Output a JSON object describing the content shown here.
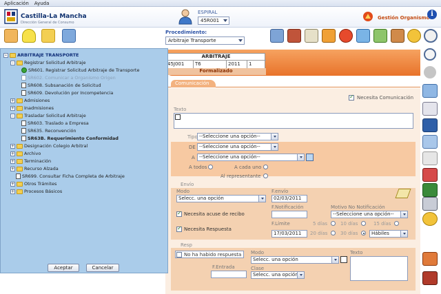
{
  "menubar": {
    "items": [
      "Aplicación",
      "Ayuda"
    ]
  },
  "header": {
    "brand_name": "Castilla-La Mancha",
    "brand_sub": "Dirección General de Consumo",
    "user_label": "ESPIRAL",
    "user_value": "45R001",
    "gestion_label": "Gestión Organismo",
    "info_icon": "i"
  },
  "toolbar": {
    "procedimiento_label": "Procedimiento:",
    "procedimiento_value": "Arbitraje Transporte"
  },
  "arbitraje": {
    "title": "ARBITRAJE",
    "cells": [
      "45J001",
      "T6",
      "2011",
      "1"
    ],
    "state": "Formalizado"
  },
  "tab": {
    "label": "Comunicación"
  },
  "form": {
    "necesita_comunicacion": "Necesita Comunicación",
    "texto_label": "Texto",
    "tipo_label": "Tipo",
    "tipo_value": "--Seleccione una opción--",
    "de_label": "DE",
    "de_value": "--Seleccione una opción--",
    "a_label": "A",
    "a_value": "--Seleccione una opción--",
    "a_todos": "A todos",
    "a_cada_uno": "A cada uno",
    "al_representante": "Al representante",
    "envio_label": "Envío",
    "modo_label": "Modo",
    "modo_value": "Selecc. una opción",
    "f_envio_label": "F.envío",
    "f_envio_value": "02/03/2011",
    "necesita_acuse": "Necesita acuse de recibo",
    "f_notificacion_label": "F.Notificación",
    "motivo_label": "Motivo No Notificación",
    "motivo_value": "--Seleccione una opción--",
    "necesita_respuesta": "Necesita Respuesta",
    "f_limite_label": "F.Límite",
    "f_limite_value": "17/03/2011",
    "dias": [
      "5 días",
      "10 días",
      "15 días",
      "20 días",
      "30 días"
    ],
    "habiles_value": "Hábiles",
    "resp_label": "Resp",
    "no_respuesta": "No ha habido respuesta",
    "resp_modo_label": "Modo",
    "resp_modo_value": "Selecc. una opción",
    "resp_texto_label": "Texto",
    "f_entrada_label": "F.Entrada",
    "clase_label": "Clase",
    "clase_value": "Selecc. una opción"
  },
  "tree": {
    "nodes": [
      {
        "label": "ARBITRAJE TRANSPORTE",
        "type": "root"
      },
      {
        "label": "Registrar Solicitud Arbitraje",
        "type": "folder"
      },
      {
        "label": "SR601. Registrar Solicitud Arbitraje de Transporte",
        "type": "active"
      },
      {
        "label": "SR602. Comunicar a Organismo Origen",
        "type": "disabled"
      },
      {
        "label": "SR608. Subsanación de Solicitud",
        "type": "doc"
      },
      {
        "label": "SR609. Devolución por Incompetencia",
        "type": "doc"
      },
      {
        "label": "Admisiones",
        "type": "folder"
      },
      {
        "label": "Inadmisiones",
        "type": "folder"
      },
      {
        "label": "Trasladar Solicitud Arbitraje",
        "type": "folder"
      },
      {
        "label": "SR603. Traslado a Empresa",
        "type": "doc"
      },
      {
        "label": "SR635. Reconvención",
        "type": "doc"
      },
      {
        "label": "SR63B. Requerimiento Conformidad",
        "type": "docbold"
      },
      {
        "label": "Designación Colegio Arbitral",
        "type": "folder"
      },
      {
        "label": "Archivo",
        "type": "folder"
      },
      {
        "label": "Terminación",
        "type": "folder"
      },
      {
        "label": "Recurso Alzada",
        "type": "folder"
      },
      {
        "label": "SR699. Consultar Ficha Completa de Arbitraje",
        "type": "doc"
      },
      {
        "label": "Otros Trámites",
        "type": "folder"
      },
      {
        "label": "Procesos Básicos",
        "type": "folder"
      }
    ],
    "accept_label": "Aceptar",
    "cancel_label": "Cancelar"
  },
  "colors": {
    "accent_orange": "#e8732a",
    "tree_bg": "#aaccea",
    "brand_blue": "#0d2f6e"
  }
}
